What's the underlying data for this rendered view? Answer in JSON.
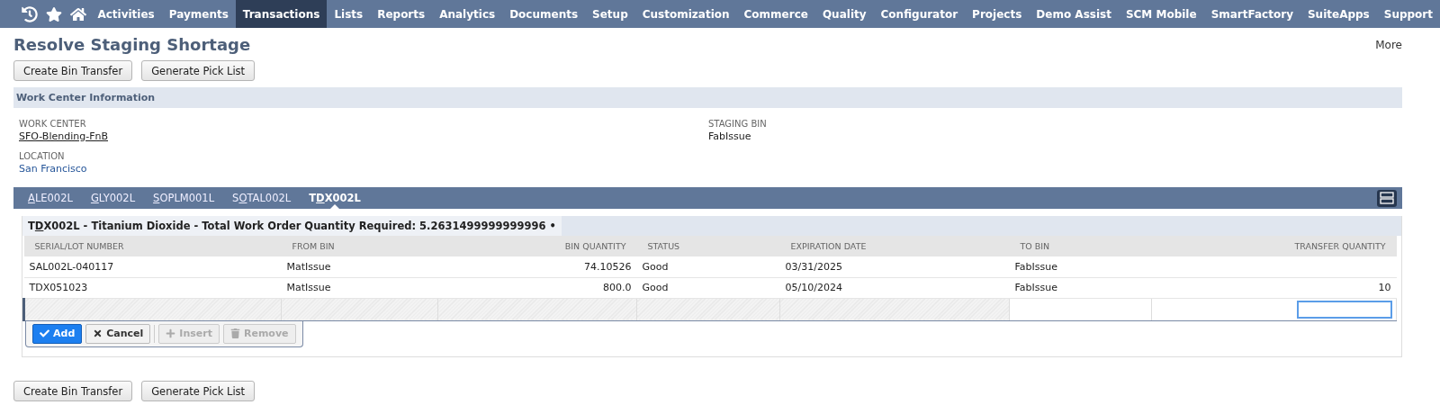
{
  "nav": {
    "items": [
      {
        "label": "Activities",
        "selected": false
      },
      {
        "label": "Payments",
        "selected": false
      },
      {
        "label": "Transactions",
        "selected": true
      },
      {
        "label": "Lists",
        "selected": false
      },
      {
        "label": "Reports",
        "selected": false
      },
      {
        "label": "Analytics",
        "selected": false
      },
      {
        "label": "Documents",
        "selected": false
      },
      {
        "label": "Setup",
        "selected": false
      },
      {
        "label": "Customization",
        "selected": false
      },
      {
        "label": "Commerce",
        "selected": false
      },
      {
        "label": "Quality",
        "selected": false
      },
      {
        "label": "Configurator",
        "selected": false
      },
      {
        "label": "Projects",
        "selected": false
      },
      {
        "label": "Demo Assist",
        "selected": false
      },
      {
        "label": "SCM Mobile",
        "selected": false
      },
      {
        "label": "SmartFactory",
        "selected": false
      },
      {
        "label": "SuiteApps",
        "selected": false
      },
      {
        "label": "Support",
        "selected": false
      }
    ]
  },
  "page": {
    "title": "Resolve Staging Shortage",
    "more": "More"
  },
  "top_buttons": [
    "Create Bin Transfer",
    "Generate Pick List"
  ],
  "section": {
    "title": "Work Center Information",
    "fields": [
      {
        "label": "WORK CENTER",
        "value": "SFO-Blending-FnB",
        "kind": "link"
      },
      {
        "label": "STAGING BIN",
        "value": "FabIssue",
        "kind": "text"
      },
      {
        "label": "LOCATION",
        "value": "San Francisco",
        "kind": "colored"
      }
    ]
  },
  "tabs": [
    {
      "key": "A",
      "after": "LE002L",
      "selected": false
    },
    {
      "key": "G",
      "after": "LY002L",
      "selected": false
    },
    {
      "key": "S",
      "after": "OPLM001L",
      "selected": false
    },
    {
      "before": "S",
      "key": "O",
      "after": "TAL002L",
      "selected": false
    },
    {
      "before": "T",
      "key": "D",
      "after": "X002L",
      "selected": true
    }
  ],
  "sublist": {
    "before": "T",
    "key": "D",
    "after": "X002L - Titanium Dioxide - Total Work Order Quantity Required: 5.2631499999999996 •",
    "columns": [
      {
        "label": "SERIAL/LOT NUMBER",
        "kind": "text"
      },
      {
        "label": "FROM BIN",
        "kind": "text"
      },
      {
        "label": "BIN QUANTITY",
        "kind": "number"
      },
      {
        "label": "STATUS",
        "kind": "text"
      },
      {
        "label": "EXPIRATION DATE",
        "kind": "text"
      },
      {
        "label": "TO BIN",
        "kind": "text"
      },
      {
        "label": "TRANSFER QUANTITY",
        "kind": "number"
      }
    ],
    "rows": [
      [
        "SAL002L-040117",
        "MatIssue",
        "74.10526",
        "Good",
        "03/31/2025",
        "FabIssue",
        ""
      ],
      [
        "TDX051023",
        "MatIssue",
        "800.0",
        "Good",
        "05/10/2024",
        "FabIssue",
        "10"
      ]
    ],
    "actions": [
      {
        "label": "Add",
        "kind": "primary",
        "disabled": false
      },
      {
        "label": "Cancel",
        "kind": "cancel",
        "disabled": false
      },
      {
        "label": "Insert",
        "kind": "insert",
        "disabled": true
      },
      {
        "label": "Remove",
        "kind": "remove",
        "disabled": true
      }
    ]
  },
  "bottom_buttons": [
    "Create Bin Transfer",
    "Generate Pick List"
  ]
}
